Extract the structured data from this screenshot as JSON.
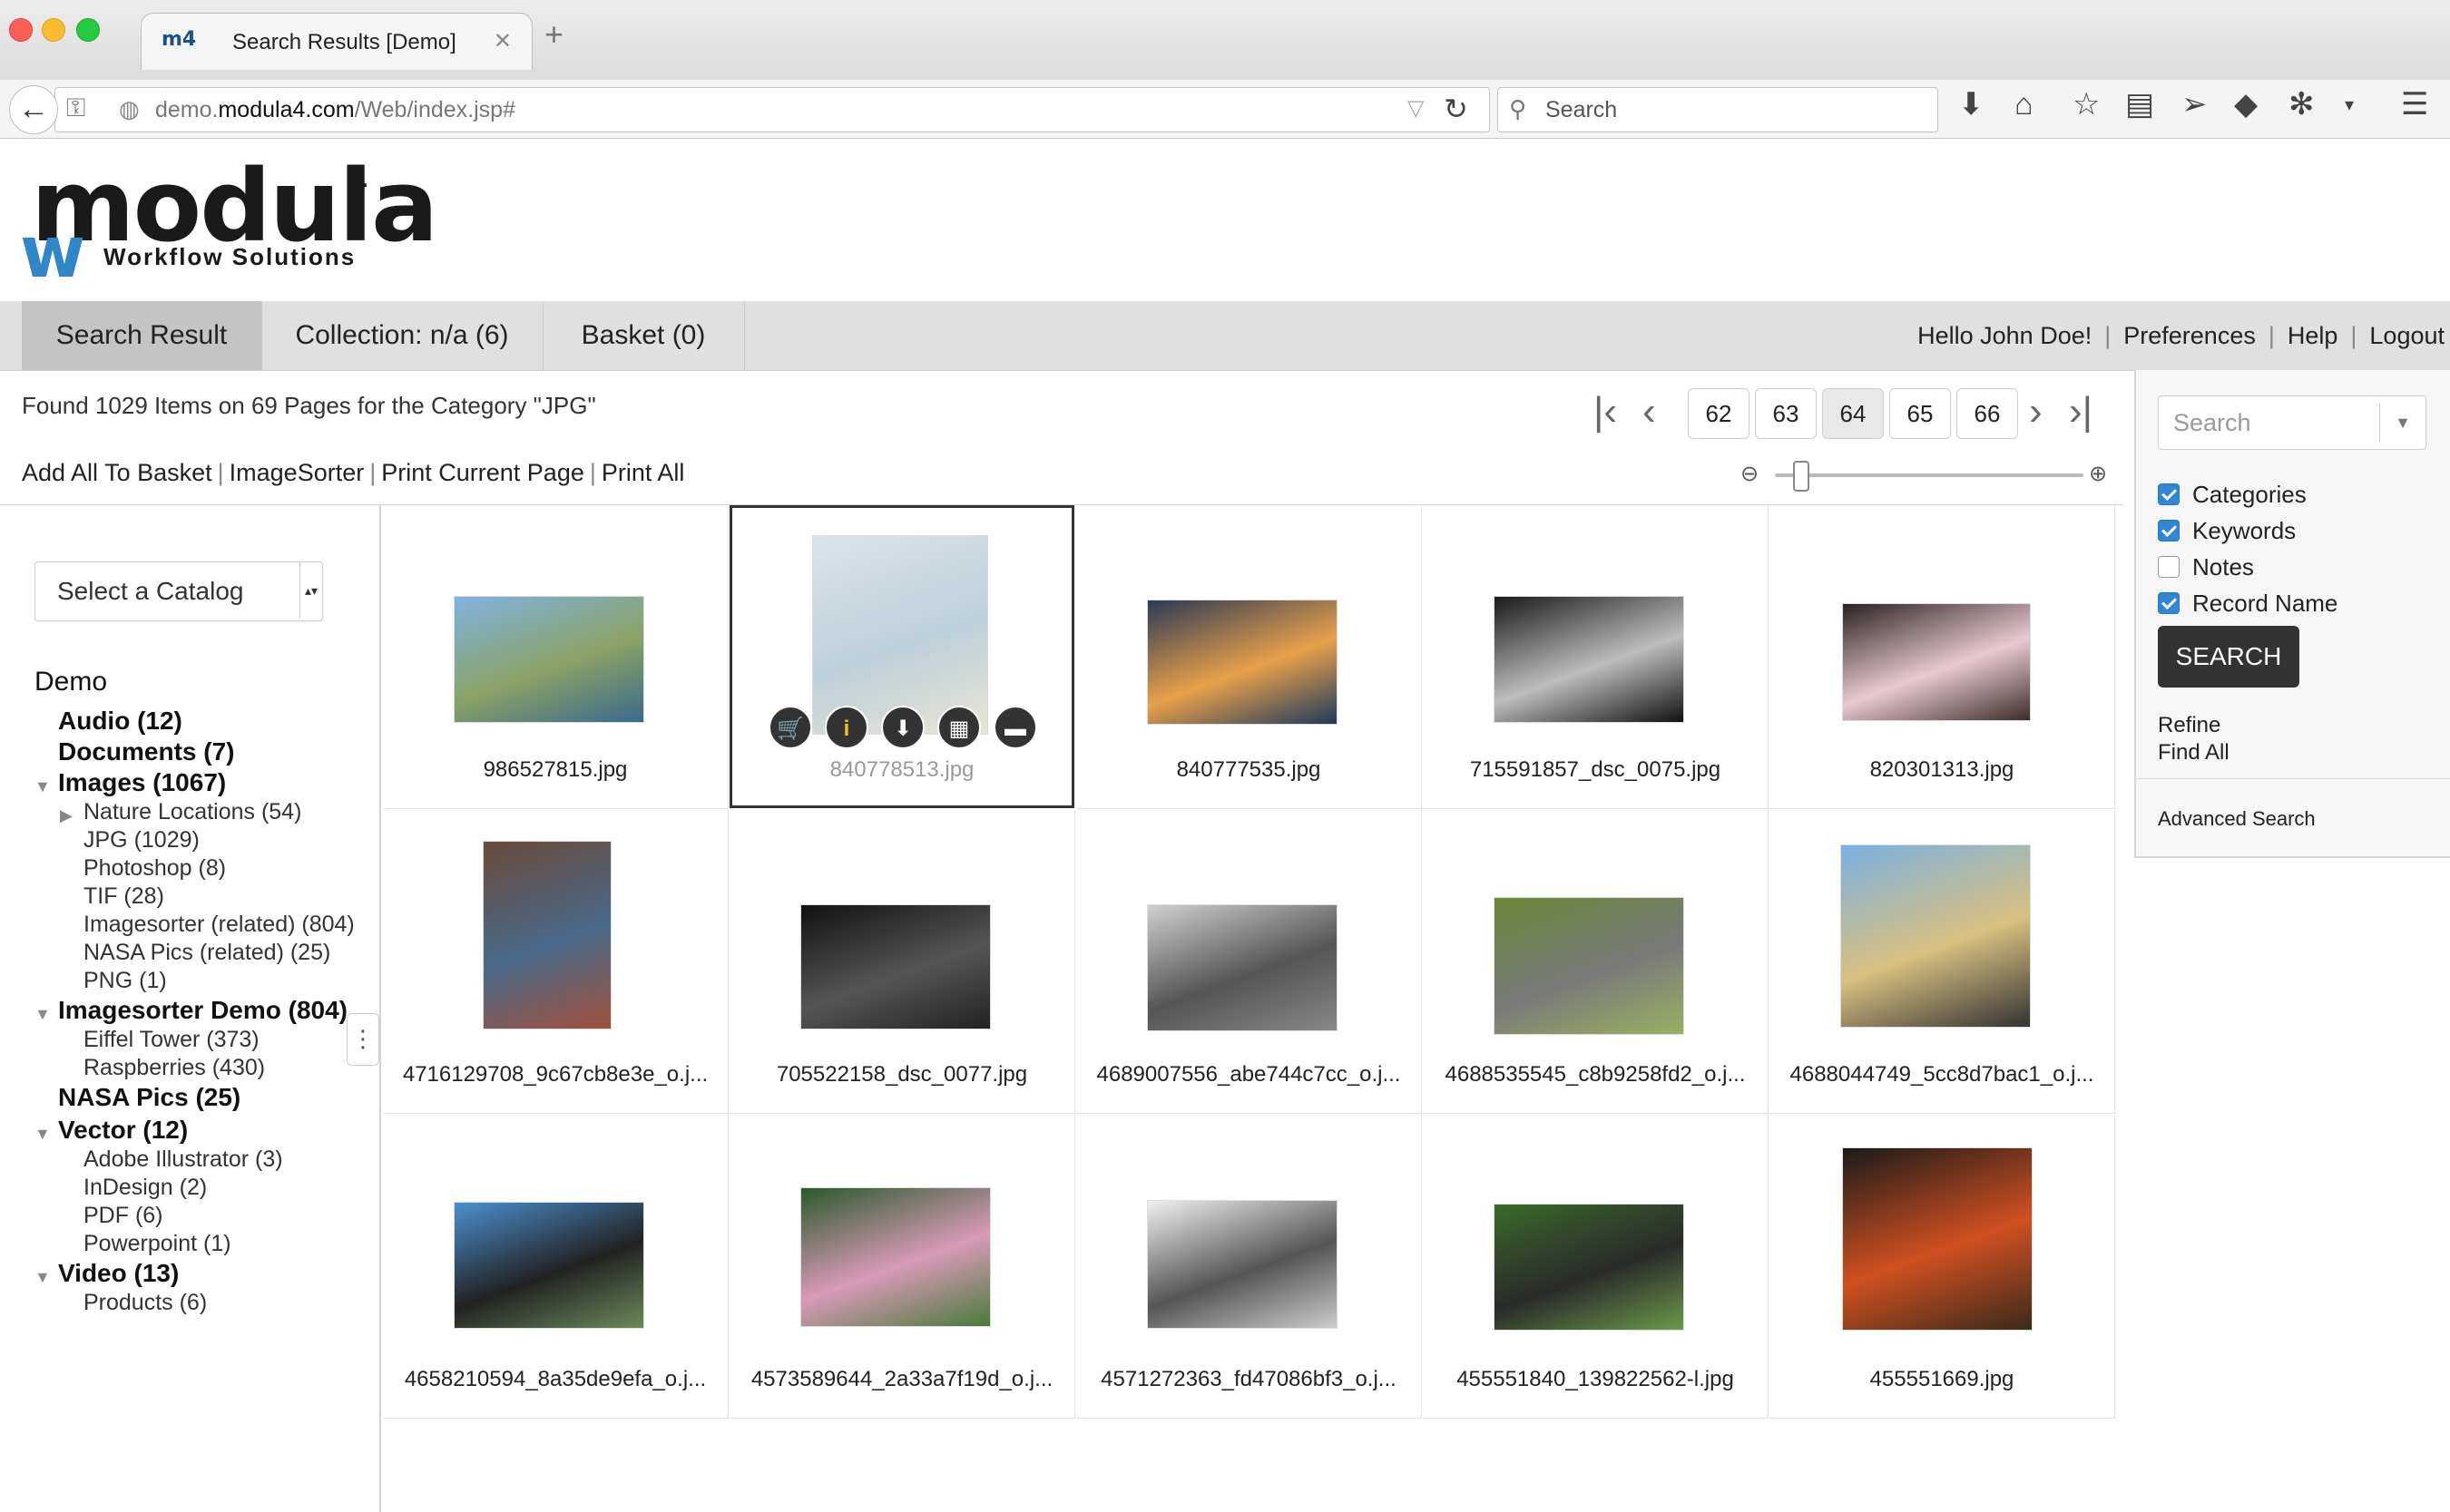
{
  "browser": {
    "tab_title": "Search Results [Demo]",
    "favicon_text": "m4",
    "url_prefix": "demo.",
    "url_domain": "modula4.com",
    "url_path": "/Web/index.jsp#",
    "search_placeholder": "Search"
  },
  "logo": {
    "word": "modula",
    "sup": "4",
    "mark": "w",
    "subtitle": "Workflow Solutions"
  },
  "tabs": [
    {
      "label": "Search Result"
    },
    {
      "label": "Collection: n/a (6)"
    },
    {
      "label": "Basket (0)"
    }
  ],
  "user": {
    "greeting": "Hello John Doe!",
    "preferences": "Preferences",
    "help": "Help",
    "logout": "Logout"
  },
  "results": {
    "found_text": "Found 1029 Items on 69 Pages for the Category \"JPG\"",
    "actions": [
      "Add All To Basket",
      "ImageSorter",
      "Print Current Page",
      "Print All"
    ]
  },
  "pager": {
    "pages": [
      "62",
      "63",
      "64",
      "65",
      "66"
    ],
    "current": "64"
  },
  "zoom": {
    "level": 0.05
  },
  "sidebar": {
    "catalog_placeholder": "Select a Catalog",
    "root": "Demo",
    "tree": [
      {
        "label": "Audio (12)",
        "level": 1
      },
      {
        "label": "Documents (7)",
        "level": 1
      },
      {
        "label": "Images (1067)",
        "level": 1,
        "expanded": true
      },
      {
        "label": "Nature Locations (54)",
        "level": 2,
        "collapsed": true
      },
      {
        "label": "JPG (1029)",
        "level": 2
      },
      {
        "label": "Photoshop (8)",
        "level": 2
      },
      {
        "label": "TIF (28)",
        "level": 2
      },
      {
        "label": "Imagesorter (related) (804)",
        "level": 2
      },
      {
        "label": "NASA Pics (related) (25)",
        "level": 2
      },
      {
        "label": "PNG (1)",
        "level": 2
      },
      {
        "label": "Imagesorter Demo (804)",
        "level": 1,
        "expanded": true
      },
      {
        "label": "Eiffel Tower (373)",
        "level": 2
      },
      {
        "label": "Raspberries (430)",
        "level": 2
      },
      {
        "label": "NASA Pics (25)",
        "level": 1
      },
      {
        "label": "Vector (12)",
        "level": 1,
        "expanded": true
      },
      {
        "label": "Adobe Illustrator (3)",
        "level": 2
      },
      {
        "label": "InDesign (2)",
        "level": 2
      },
      {
        "label": "PDF (6)",
        "level": 2
      },
      {
        "label": "Powerpoint (1)",
        "level": 2
      },
      {
        "label": "Video (13)",
        "level": 1,
        "expanded": true
      },
      {
        "label": "Products (6)",
        "level": 2
      }
    ]
  },
  "grid": {
    "items": [
      {
        "name": "986527815.jpg",
        "colors": [
          "#7fb2e0",
          "#8aa266",
          "#3b6a8c"
        ]
      },
      {
        "name": "840778513.jpg",
        "colors": [
          "#d9e4ea",
          "#bcd0d8",
          "#e9e4d6"
        ],
        "selected": true
      },
      {
        "name": "840777535.jpg",
        "colors": [
          "#2b3a55",
          "#e8a04a",
          "#1e3a5c"
        ]
      },
      {
        "name": "715591857_dsc_0075.jpg",
        "colors": [
          "#1a1a1a",
          "#bdbdbd",
          "#111111"
        ]
      },
      {
        "name": "820301313.jpg",
        "colors": [
          "#2a2220",
          "#e9c9d2",
          "#3a2d2a"
        ]
      },
      {
        "name": "4716129708_9c67cb8e3e_o.j...",
        "colors": [
          "#6a4a3a",
          "#4a6a8a",
          "#a0503a"
        ]
      },
      {
        "name": "705522158_dsc_0077.jpg",
        "colors": [
          "#111111",
          "#555555",
          "#222222"
        ]
      },
      {
        "name": "4689007556_abe744c7cc_o.j...",
        "colors": [
          "#d0d0d0",
          "#555555",
          "#888888"
        ]
      },
      {
        "name": "4688535545_c8b9258fd2_o.j...",
        "colors": [
          "#6a8a3a",
          "#7a7a7a",
          "#9ab060"
        ]
      },
      {
        "name": "4688044749_5cc8d7bac1_o.j...",
        "colors": [
          "#7ab0e0",
          "#d8c080",
          "#333333"
        ]
      },
      {
        "name": "4658210594_8a35de9efa_o.j...",
        "colors": [
          "#4a90d0",
          "#222222",
          "#6a8a5a"
        ]
      },
      {
        "name": "4573589644_2a33a7f19d_o.j...",
        "colors": [
          "#2a5a2a",
          "#d89ab8",
          "#4a7a3a"
        ]
      },
      {
        "name": "4571272363_fd47086bf3_o.j...",
        "colors": [
          "#f0f0f0",
          "#555555",
          "#cccccc"
        ]
      },
      {
        "name": "455551840_139822562-l.jpg",
        "colors": [
          "#3a6a2a",
          "#2a2a2a",
          "#6a9a4a"
        ]
      },
      {
        "name": "455551669.jpg",
        "colors": [
          "#1a1a1a",
          "#d05020",
          "#3a2a1a"
        ]
      }
    ],
    "overlay_icons": [
      "cart-add-icon",
      "info-icon",
      "download-icon",
      "grid-icon",
      "minus-icon"
    ]
  },
  "right_panel": {
    "search_placeholder": "Search",
    "checks": [
      {
        "label": "Categories",
        "checked": true
      },
      {
        "label": "Keywords",
        "checked": true
      },
      {
        "label": "Notes",
        "checked": false
      },
      {
        "label": "Record Name",
        "checked": true
      }
    ],
    "search_button": "SEARCH",
    "links": [
      "Refine",
      "Find All"
    ],
    "advanced": "Advanced Search"
  },
  "accent": "#2f86d6"
}
